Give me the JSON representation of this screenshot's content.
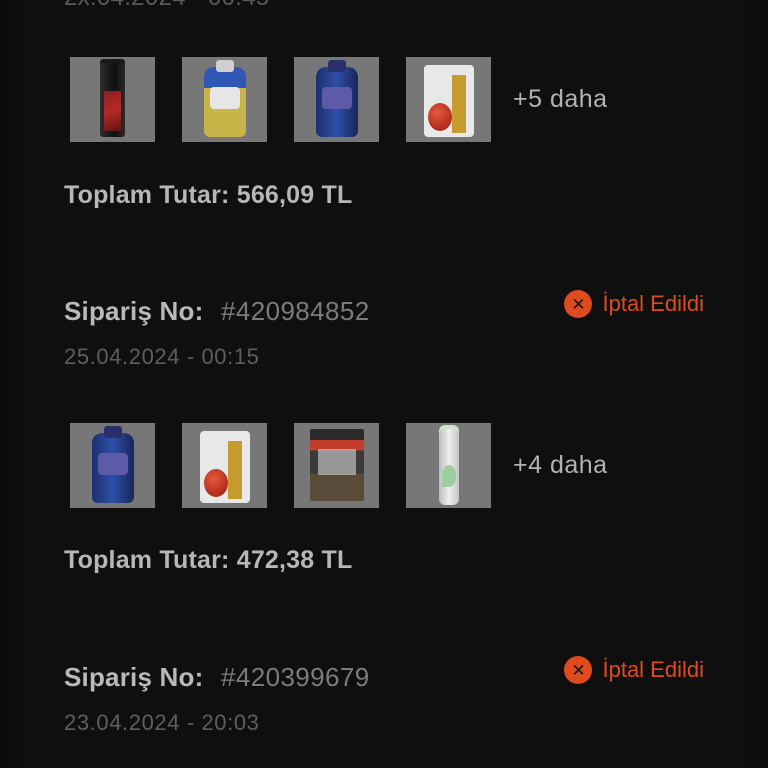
{
  "header": {
    "top_cut_text": "2x.04.2024 - 00:45"
  },
  "orders": [
    {
      "thumbs": [
        "Blade deodorant",
        "Pril bottle",
        "Perwoll bottle",
        "Bag product"
      ],
      "more_text": "+5 daha",
      "total_label": "Toplam Tutar:",
      "total_value": "566,09 TL"
    },
    {
      "order_no_label": "Sipariş No:",
      "order_no_value": "#420984852",
      "date": "25.04.2024 - 00:15",
      "status_text": "İptal Edildi",
      "thumbs": [
        "Perwoll bottle",
        "Bag product",
        "Boxed product",
        "Spray product"
      ],
      "more_text": "+4 daha",
      "total_label": "Toplam Tutar:",
      "total_value": "472,38 TL"
    },
    {
      "order_no_label": "Sipariş No:",
      "order_no_value": "#420399679",
      "date": "23.04.2024 - 20:03",
      "status_text": "İptal Edildi"
    }
  ],
  "colors": {
    "background": "#0f0f10",
    "status": "#e04b1d",
    "text_primary": "#b7b7b7",
    "text_muted": "#5e5e5e"
  }
}
